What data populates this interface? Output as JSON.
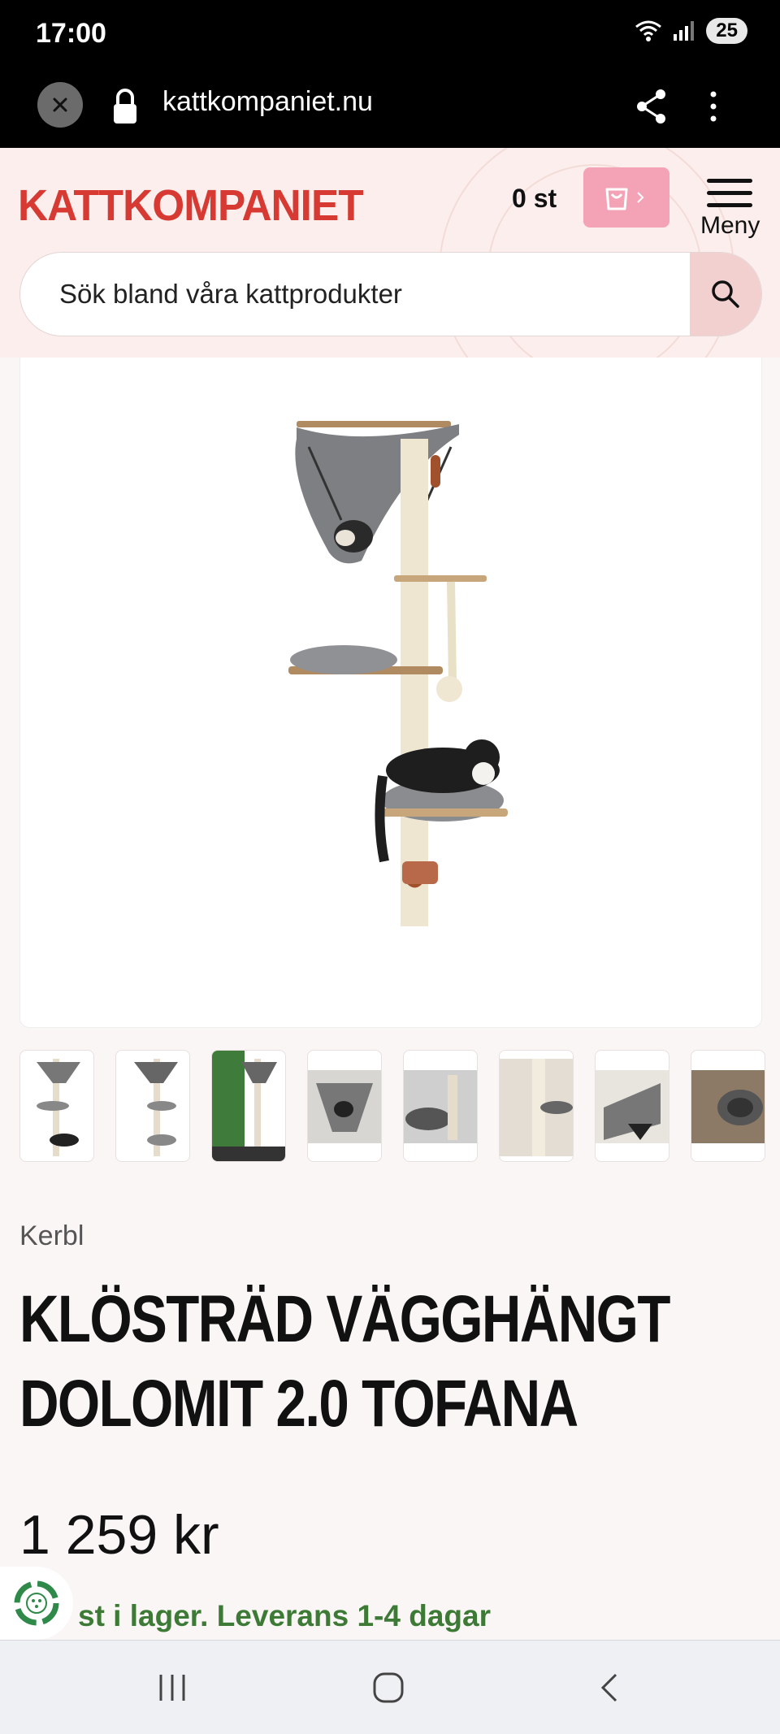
{
  "status_bar": {
    "time": "17:00",
    "battery": "25"
  },
  "browser": {
    "url": "kattkompaniet.nu"
  },
  "header": {
    "logo": "KATTKOMPANIET",
    "cart_count": "0 st",
    "menu_label": "Meny",
    "search_placeholder": "Sök bland våra kattprodukter"
  },
  "product": {
    "brand": "Kerbl",
    "title_line1": "KLÖSTRÄD VÄGGHÄNGT",
    "title_line2": "DOLOMIT 2.0 TOFANA",
    "price": "1 259 kr",
    "stock": "st i lager. Leverans 1-4 dagar",
    "thumbnail_count": 8
  },
  "colors": {
    "brand_red": "#d63a32",
    "cart_pink": "#f4a3b7",
    "header_bg": "#fbeeec",
    "stock_green": "#3d7a36"
  }
}
